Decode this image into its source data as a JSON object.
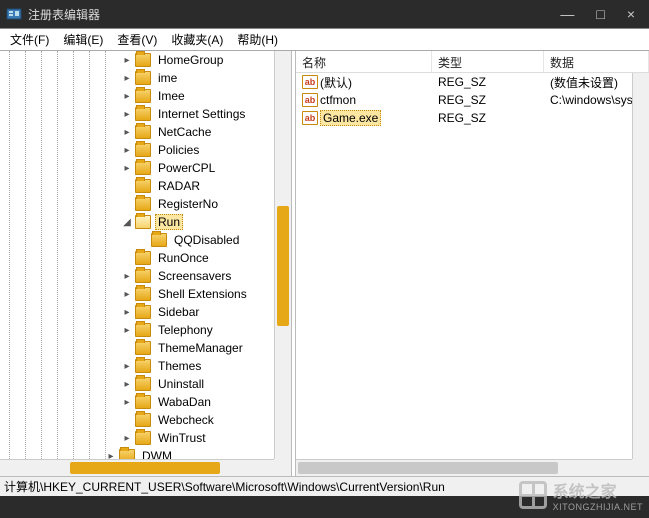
{
  "window": {
    "title": "注册表编辑器",
    "controls": {
      "min": "—",
      "max": "□",
      "close": "×"
    }
  },
  "menu": {
    "file": "文件(F)",
    "edit": "编辑(E)",
    "view": "查看(V)",
    "fav": "收藏夹(A)",
    "help": "帮助(H)"
  },
  "tree": {
    "items": [
      {
        "label": "HomeGroup",
        "indent": 8,
        "exp": "▸"
      },
      {
        "label": "ime",
        "indent": 8,
        "exp": "▸"
      },
      {
        "label": "Imee",
        "indent": 8,
        "exp": "▸"
      },
      {
        "label": "Internet Settings",
        "indent": 8,
        "exp": "▸"
      },
      {
        "label": "NetCache",
        "indent": 8,
        "exp": "▸"
      },
      {
        "label": "Policies",
        "indent": 8,
        "exp": "▸"
      },
      {
        "label": "PowerCPL",
        "indent": 8,
        "exp": "▸"
      },
      {
        "label": "RADAR",
        "indent": 8,
        "exp": ""
      },
      {
        "label": "RegisterNo",
        "indent": 8,
        "exp": ""
      },
      {
        "label": "Run",
        "indent": 8,
        "exp": "◢",
        "selected": true,
        "open": true
      },
      {
        "label": "QQDisabled",
        "indent": 9,
        "exp": ""
      },
      {
        "label": "RunOnce",
        "indent": 8,
        "exp": ""
      },
      {
        "label": "Screensavers",
        "indent": 8,
        "exp": "▸"
      },
      {
        "label": "Shell Extensions",
        "indent": 8,
        "exp": "▸"
      },
      {
        "label": "Sidebar",
        "indent": 8,
        "exp": "▸"
      },
      {
        "label": "Telephony",
        "indent": 8,
        "exp": "▸"
      },
      {
        "label": "ThemeManager",
        "indent": 8,
        "exp": ""
      },
      {
        "label": "Themes",
        "indent": 8,
        "exp": "▸"
      },
      {
        "label": "Uninstall",
        "indent": 8,
        "exp": "▸"
      },
      {
        "label": "WabaDan",
        "indent": 8,
        "exp": "▸"
      },
      {
        "label": "Webcheck",
        "indent": 8,
        "exp": ""
      },
      {
        "label": "WinTrust",
        "indent": 8,
        "exp": "▸"
      },
      {
        "label": "DWM",
        "indent": 7,
        "exp": "▸"
      }
    ]
  },
  "list": {
    "columns": {
      "name": "名称",
      "type": "类型",
      "data": "数据"
    },
    "rows": [
      {
        "name": "(默认)",
        "type": "REG_SZ",
        "data_": "(数值未设置)"
      },
      {
        "name": "ctfmon",
        "type": "REG_SZ",
        "data_": "C:\\windows\\sys"
      },
      {
        "name": "Game.exe",
        "type": "REG_SZ",
        "data_": "",
        "selected": true
      }
    ]
  },
  "status": {
    "path": "计算机\\HKEY_CURRENT_USER\\Software\\Microsoft\\Windows\\CurrentVersion\\Run"
  },
  "watermark": {
    "brand": "系统之家",
    "url": "XITONGZHIJIA.NET"
  }
}
